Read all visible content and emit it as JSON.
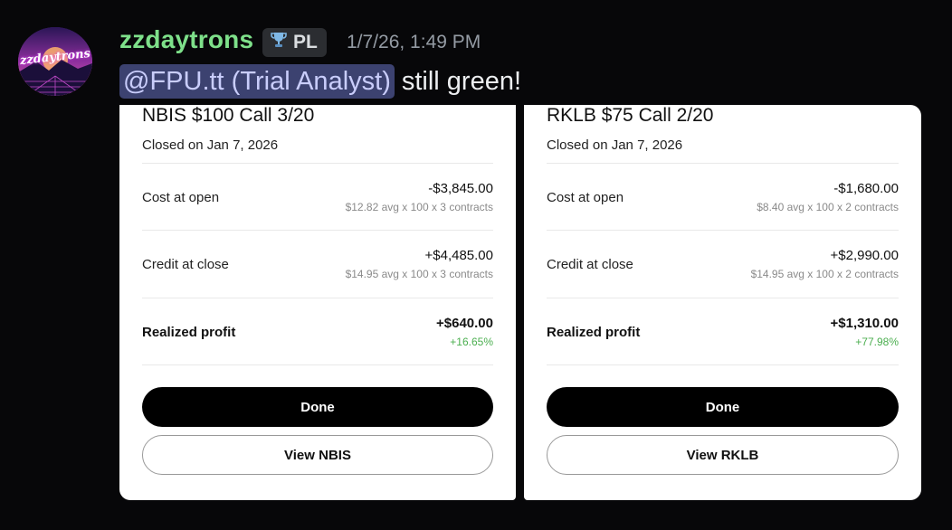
{
  "message": {
    "author": "zzdaytrons",
    "avatar_text": "zzdaytrons",
    "badge_icon": "trophy-icon",
    "badge_label": "PL",
    "timestamp": "1/7/26, 1:49 PM",
    "mention": "@FPU.tt (Trial Analyst)",
    "text": "still green!"
  },
  "cards": [
    {
      "title": "NBIS $100 Call 3/20",
      "closed": "Closed on Jan 7, 2026",
      "cost_label": "Cost at open",
      "cost_value": "-$3,845.00",
      "cost_detail": "$12.82 avg x 100 x 3 contracts",
      "credit_label": "Credit at close",
      "credit_value": "+$4,485.00",
      "credit_detail": "$14.95 avg x 100 x 3 contracts",
      "profit_label": "Realized profit",
      "profit_value": "+$640.00",
      "profit_pct": "+16.65%",
      "done_label": "Done",
      "view_label": "View NBIS"
    },
    {
      "title": "RKLB $75 Call 2/20",
      "closed": "Closed on Jan 7, 2026",
      "cost_label": "Cost at open",
      "cost_value": "-$1,680.00",
      "cost_detail": "$8.40 avg x 100 x 2 contracts",
      "credit_label": "Credit at close",
      "credit_value": "+$2,990.00",
      "credit_detail": "$14.95 avg x 100 x 2 contracts",
      "profit_label": "Realized profit",
      "profit_value": "+$1,310.00",
      "profit_pct": "+77.98%",
      "done_label": "Done",
      "view_label": "View RKLB"
    }
  ],
  "colors": {
    "username": "#7ee08a",
    "mention_bg": "#3c4270",
    "profit_green": "#4caf50"
  }
}
